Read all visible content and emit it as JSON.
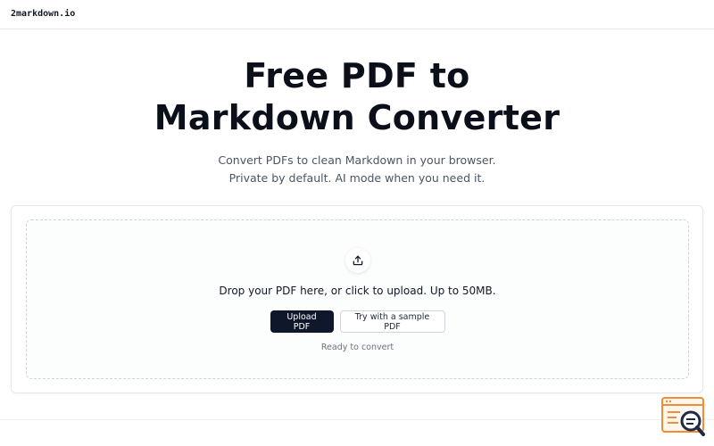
{
  "header": {
    "brand": "2markdown.io"
  },
  "hero": {
    "title_line1": "Free PDF to",
    "title_line2": "Markdown Converter",
    "subtitle_line1": "Convert PDFs to clean Markdown in your browser.",
    "subtitle_line2": "Private by default. AI mode when you need it."
  },
  "uploader": {
    "icon": "upload-icon",
    "prompt": "Drop your PDF here, or click to upload. Up to 50MB.",
    "upload_button": "Upload PDF",
    "sample_button": "Try with a sample PDF",
    "status": "Ready to convert"
  },
  "widget": {
    "icon": "search-console-icon",
    "accent": "#f28c38"
  },
  "colors": {
    "primary": "#0f172a",
    "muted_text": "#4b5563",
    "border": "#e5e7eb",
    "dash": "#cbd5e1"
  }
}
